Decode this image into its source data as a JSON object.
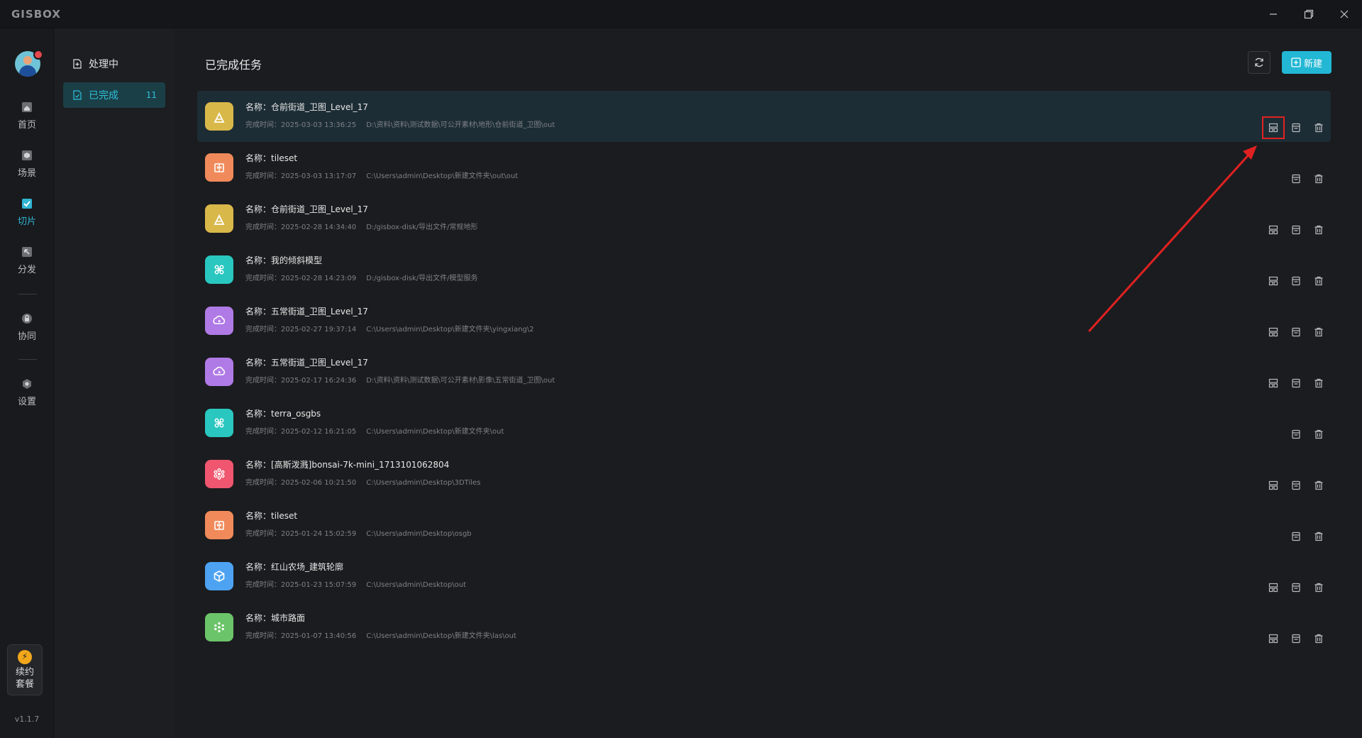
{
  "app": {
    "logo": "GISBOX"
  },
  "window_controls": {
    "minimize": "—",
    "restore": "❐",
    "close": "✕"
  },
  "rail": {
    "items": [
      {
        "label": "首页",
        "icon": "home-icon"
      },
      {
        "label": "场景",
        "icon": "scene-icon"
      },
      {
        "label": "切片",
        "icon": "slice-icon",
        "active": true
      },
      {
        "label": "分发",
        "icon": "distribute-icon"
      },
      {
        "label": "协同",
        "icon": "collab-icon"
      },
      {
        "label": "设置",
        "icon": "settings-icon"
      }
    ],
    "renew": {
      "line1": "续约",
      "line2": "套餐"
    },
    "version": "v1.1.7"
  },
  "subnav": {
    "processing": {
      "label": "处理中"
    },
    "completed": {
      "label": "已完成",
      "count": "11"
    }
  },
  "main": {
    "title": "已完成任务",
    "new_button": "新建"
  },
  "colors": {
    "accent": "#22b7d4",
    "terrain": "#d9b84a",
    "tileset": "#f08a5a",
    "oblique": "#29c7c0",
    "imagery": "#b07ae6",
    "gaussian": "#f0566f",
    "building": "#4da3f2",
    "pointcloud": "#6cc46a"
  },
  "tasks": [
    {
      "name": "名称：仓前街道_卫图_Level_17",
      "time": "完成时间：2025-03-03 13:36:25",
      "path": "D:\\资料\\资料\\测试数据\\可公开素材\\地形\\仓前街道_卫图\\out",
      "type": "terrain",
      "actions": 3
    },
    {
      "name": "名称：tileset",
      "time": "完成时间：2025-03-03 13:17:07",
      "path": "C:\\Users\\admin\\Desktop\\新建文件夹\\out\\out",
      "type": "tileset",
      "actions": 2
    },
    {
      "name": "名称：仓前街道_卫图_Level_17",
      "time": "完成时间：2025-02-28 14:34:40",
      "path": "D:/gisbox-disk/导出文件/常规地形",
      "type": "terrain",
      "actions": 3
    },
    {
      "name": "名称：我的倾斜模型",
      "time": "完成时间：2025-02-28 14:23:09",
      "path": "D:/gisbox-disk/导出文件/模型服务",
      "type": "oblique",
      "actions": 3
    },
    {
      "name": "名称：五常街道_卫图_Level_17",
      "time": "完成时间：2025-02-27 19:37:14",
      "path": "C:\\Users\\admin\\Desktop\\新建文件夹\\yingxiang\\2",
      "type": "imagery",
      "actions": 3
    },
    {
      "name": "名称：五常街道_卫图_Level_17",
      "time": "完成时间：2025-02-17 16:24:36",
      "path": "D:\\资料\\资料\\测试数据\\可公开素材\\影像\\五常街道_卫图\\out",
      "type": "imagery",
      "actions": 3
    },
    {
      "name": "名称：terra_osgbs",
      "time": "完成时间：2025-02-12 16:21:05",
      "path": "C:\\Users\\admin\\Desktop\\新建文件夹\\out",
      "type": "oblique",
      "actions": 2
    },
    {
      "name": "名称：[高斯泼溅]bonsai-7k-mini_1713101062804",
      "time": "完成时间：2025-02-06 10:21:50",
      "path": "C:\\Users\\admin\\Desktop\\3DTiles",
      "type": "gaussian",
      "actions": 3
    },
    {
      "name": "名称：tileset",
      "time": "完成时间：2025-01-24 15:02:59",
      "path": "C:\\Users\\admin\\Desktop\\osgb",
      "type": "tileset",
      "actions": 2
    },
    {
      "name": "名称：红山农场_建筑轮廓",
      "time": "完成时间：2025-01-23 15:07:59",
      "path": "C:\\Users\\admin\\Desktop\\out",
      "type": "building",
      "actions": 3
    },
    {
      "name": "名称：城市路面",
      "time": "完成时间：2025-01-07 13:40:56",
      "path": "C:\\Users\\admin\\Desktop\\新建文件夹\\las\\out",
      "type": "pointcloud",
      "actions": 3
    }
  ]
}
